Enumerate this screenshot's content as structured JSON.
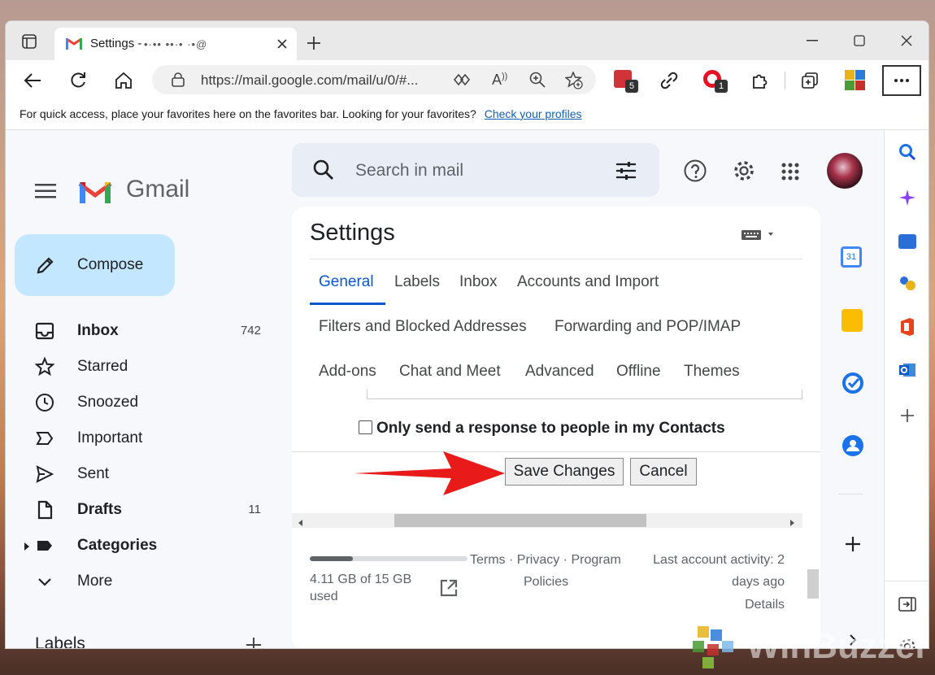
{
  "browser": {
    "tab_title": "Settings -",
    "tab_title_obscured": "•·•• ••·• ·•@",
    "url": "https://mail.google.com/mail/u/0/#...",
    "extension_badges": {
      "todo": "5",
      "office": "1"
    },
    "favorites_bar": {
      "message": "For quick access, place your favorites here on the favorites bar. Looking for your favorites?",
      "link": "Check your profiles"
    }
  },
  "gmail": {
    "logo_text": "Gmail",
    "search_placeholder": "Search in mail",
    "compose_label": "Compose",
    "nav": [
      {
        "label": "Inbox",
        "count": "742",
        "bold": true,
        "icon": "inbox-icon"
      },
      {
        "label": "Starred",
        "count": "",
        "bold": false,
        "icon": "star-icon"
      },
      {
        "label": "Snoozed",
        "count": "",
        "bold": false,
        "icon": "clock-icon"
      },
      {
        "label": "Important",
        "count": "",
        "bold": false,
        "icon": "important-icon"
      },
      {
        "label": "Sent",
        "count": "",
        "bold": false,
        "icon": "send-icon"
      },
      {
        "label": "Drafts",
        "count": "11",
        "bold": true,
        "icon": "draft-icon"
      },
      {
        "label": "Categories",
        "count": "",
        "bold": true,
        "icon": "label-icon"
      },
      {
        "label": "More",
        "count": "",
        "bold": false,
        "icon": "chevron-down-icon"
      }
    ],
    "labels_heading": "Labels"
  },
  "settings": {
    "title": "Settings",
    "tabs_row1": [
      "General",
      "Labels",
      "Inbox",
      "Accounts and Import"
    ],
    "tabs_row2": [
      "Filters and Blocked Addresses",
      "Forwarding and POP/IMAP"
    ],
    "tabs_row3": [
      "Add-ons",
      "Chat and Meet",
      "Advanced",
      "Offline",
      "Themes"
    ],
    "active_tab": "General",
    "contacts_only_checkbox_label": "Only send a response to people in my Contacts",
    "contacts_only_checked": false,
    "save_button": "Save Changes",
    "cancel_button": "Cancel"
  },
  "footer": {
    "storage_used": "4.11 GB of 15 GB",
    "storage_used_suffix": "used",
    "storage_fraction": 0.274,
    "terms": "Terms · Privacy · Program",
    "policies": "Policies",
    "activity_line1": "Last account activity: 2",
    "activity_line2": "days ago",
    "details": "Details"
  },
  "watermark": "WinBuzzer",
  "colors": {
    "gmail_bg": "#f6f8fc",
    "compose_bg": "#c2e7ff",
    "accent_blue": "#0b57d0",
    "annotation_arrow": "#e81a1a"
  }
}
